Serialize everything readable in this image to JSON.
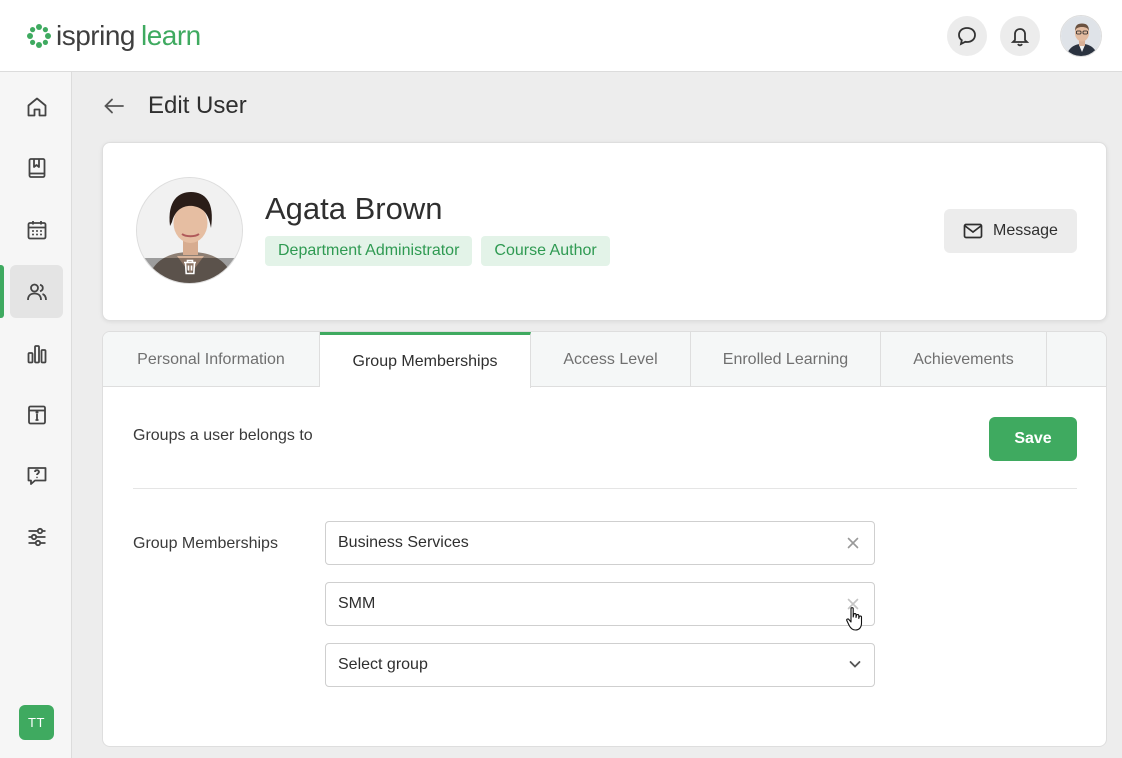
{
  "brand": {
    "name_part1": "ispring",
    "name_part2": "learn",
    "accent": "#3faa60"
  },
  "topbar": {
    "icons": [
      "chat-icon",
      "bell-icon",
      "user-avatar"
    ]
  },
  "sidebar": {
    "items": [
      "home-icon",
      "book-icon",
      "calendar-icon",
      "users-icon",
      "reports-icon",
      "info-icon",
      "question-icon",
      "settings-sliders-icon"
    ],
    "active_item": "users-icon",
    "user_initials": "TT"
  },
  "page": {
    "title": "Edit User"
  },
  "profile": {
    "name": "Agata Brown",
    "roles": [
      "Department Administrator",
      "Course Author"
    ],
    "message_label": "Message"
  },
  "tabs": [
    "Personal Information",
    "Group Memberships",
    "Access Level",
    "Enrolled Learning",
    "Achievements"
  ],
  "active_tab": "Group Memberships",
  "group_section": {
    "description": "Groups a user belongs to",
    "save_label": "Save",
    "field_label": "Group Memberships",
    "groups": [
      "Business Services",
      "SMM"
    ],
    "select_placeholder": "Select group"
  }
}
